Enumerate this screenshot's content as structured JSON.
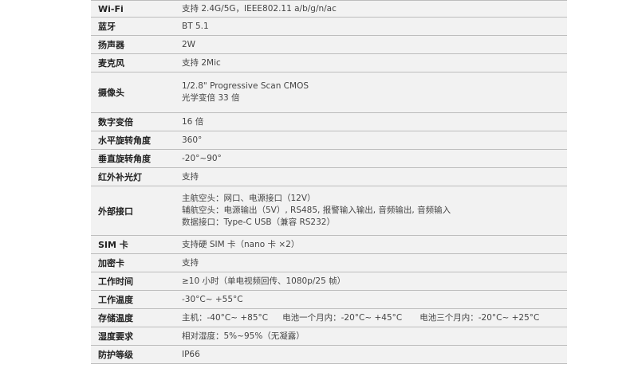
{
  "specs": [
    {
      "label": "Wi-Fi",
      "values": [
        "支持 2.4G/5G，IEEE802.11 a/b/g/n/ac"
      ]
    },
    {
      "label": "蓝牙",
      "values": [
        "BT 5.1"
      ]
    },
    {
      "label": "扬声器",
      "values": [
        "2W"
      ]
    },
    {
      "label": "麦克风",
      "values": [
        "支持 2Mic"
      ]
    },
    {
      "label": "摄像头",
      "values": [
        "1/2.8\" Progressive Scan CMOS",
        "光学变倍 33 倍"
      ]
    },
    {
      "label": "数字变倍",
      "values": [
        "16 倍"
      ]
    },
    {
      "label": "水平旋转角度",
      "values": [
        "360°"
      ]
    },
    {
      "label": "垂直旋转角度",
      "values": [
        "-20°~90°"
      ]
    },
    {
      "label": "红外补光灯",
      "values": [
        "支持"
      ]
    },
    {
      "label": "外部接口",
      "values": [
        "主航空头：网口、电源接口（12V）",
        "辅航空头：电源输出（5V）, RS485, 报警输入输出, 音频输出, 音频输入",
        "数据接口：Type-C USB（兼容 RS232）"
      ]
    },
    {
      "label": "SIM 卡",
      "values": [
        "支持硬 SIM 卡（nano 卡 ×2）"
      ]
    },
    {
      "label": "加密卡",
      "values": [
        "支持"
      ]
    },
    {
      "label": "工作时间",
      "values": [
        "≥10 小时（单电视频回传、1080p/25 帧）"
      ]
    },
    {
      "label": "工作温度",
      "values": [
        "-30°C~ +55°C"
      ]
    },
    {
      "label": "存储温度",
      "values": [],
      "storage": [
        "主机：-40°C~ +85°C",
        "电池一个月内：-20°C~ +45°C",
        "电池三个月内：-20°C~ +25°C"
      ]
    },
    {
      "label": "湿度要求",
      "values": [
        "相对湿度：5%~95%（无凝露）"
      ]
    },
    {
      "label": "防护等级",
      "values": [
        "IP66"
      ]
    }
  ]
}
